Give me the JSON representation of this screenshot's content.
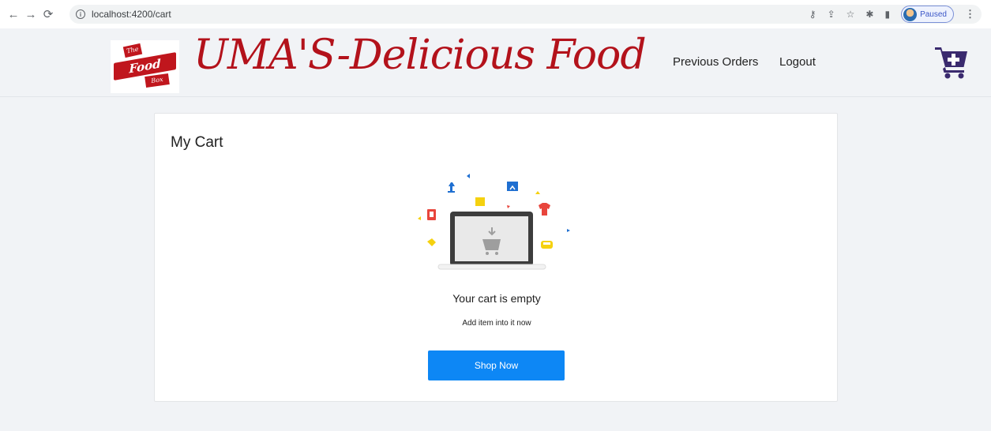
{
  "browser": {
    "url": "localhost:4200/cart",
    "profile_status": "Paused",
    "icons": [
      "back-icon",
      "forward-icon",
      "reload-icon",
      "info-icon",
      "key-icon",
      "share-icon",
      "star-icon",
      "extensions-icon",
      "sidepanel-icon",
      "menu-icon"
    ]
  },
  "header": {
    "logo": {
      "line1": "The",
      "line2": "Food",
      "line3": "Box"
    },
    "brand": "UMA'S-Delicious Food",
    "nav": {
      "previous_orders": "Previous Orders",
      "logout": "Logout"
    },
    "cart_icon": "cart-plus-icon"
  },
  "cart": {
    "title": "My Cart",
    "empty_title": "Your cart is empty",
    "empty_subtitle": "Add item into it now",
    "shop_button": "Shop Now"
  },
  "colors": {
    "brand_red": "#b3121b",
    "button_blue": "#0d87f5",
    "page_bg": "#f1f3f6",
    "cart_icon": "#3a2a6e"
  }
}
